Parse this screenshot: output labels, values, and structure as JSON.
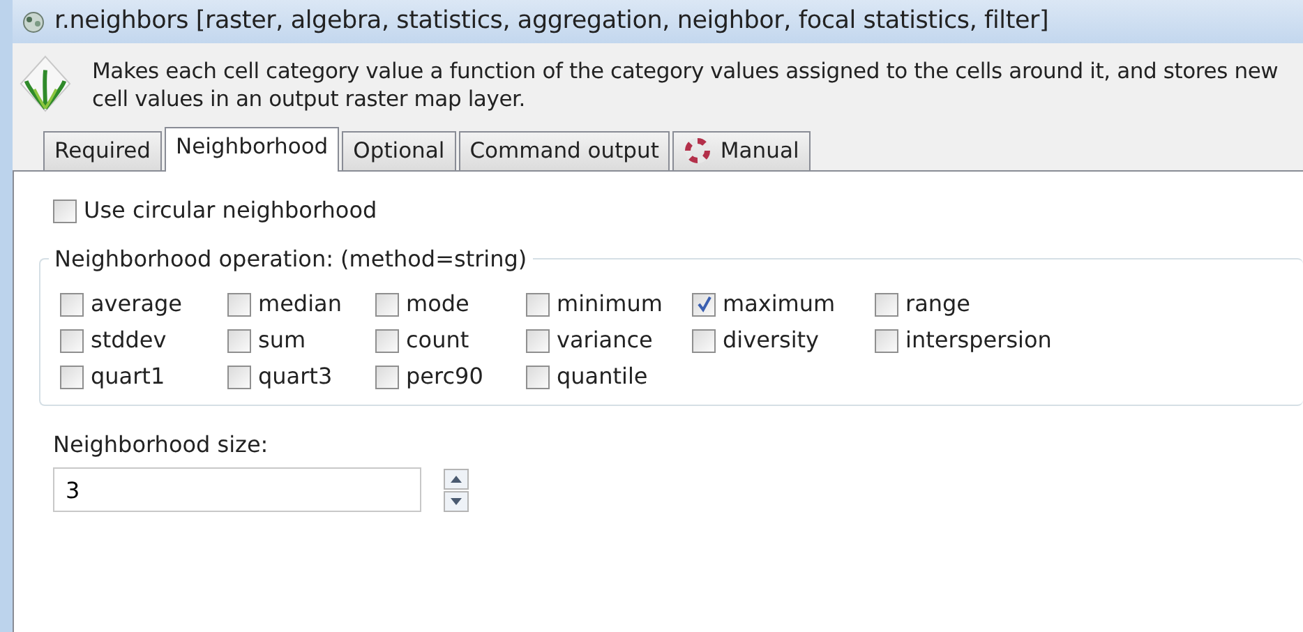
{
  "window": {
    "title": "r.neighbors [raster, algebra, statistics, aggregation, neighbor, focal statistics, filter]"
  },
  "description": "Makes each cell category value a function of the category values assigned to the cells around it, and stores new cell values in an output raster map layer.",
  "tabs": [
    {
      "label": "Required",
      "selected": false,
      "kind": "text"
    },
    {
      "label": "Neighborhood",
      "selected": true,
      "kind": "text"
    },
    {
      "label": "Optional",
      "selected": false,
      "kind": "text"
    },
    {
      "label": "Command output",
      "selected": false,
      "kind": "text"
    },
    {
      "label": "Manual",
      "selected": false,
      "kind": "help"
    }
  ],
  "circular": {
    "label": "Use circular neighborhood",
    "checked": false
  },
  "operation": {
    "title": "Neighborhood operation:  (method=string)",
    "methods": [
      {
        "label": "average",
        "checked": false
      },
      {
        "label": "median",
        "checked": false
      },
      {
        "label": "mode",
        "checked": false
      },
      {
        "label": "minimum",
        "checked": false
      },
      {
        "label": "maximum",
        "checked": true
      },
      {
        "label": "range",
        "checked": false
      },
      {
        "label": "stddev",
        "checked": false
      },
      {
        "label": "sum",
        "checked": false
      },
      {
        "label": "count",
        "checked": false
      },
      {
        "label": "variance",
        "checked": false
      },
      {
        "label": "diversity",
        "checked": false
      },
      {
        "label": "interspersion",
        "checked": false
      },
      {
        "label": "quart1",
        "checked": false
      },
      {
        "label": "quart3",
        "checked": false
      },
      {
        "label": "perc90",
        "checked": false
      },
      {
        "label": "quantile",
        "checked": false
      }
    ]
  },
  "size": {
    "label": "Neighborhood size:",
    "value": "3"
  }
}
